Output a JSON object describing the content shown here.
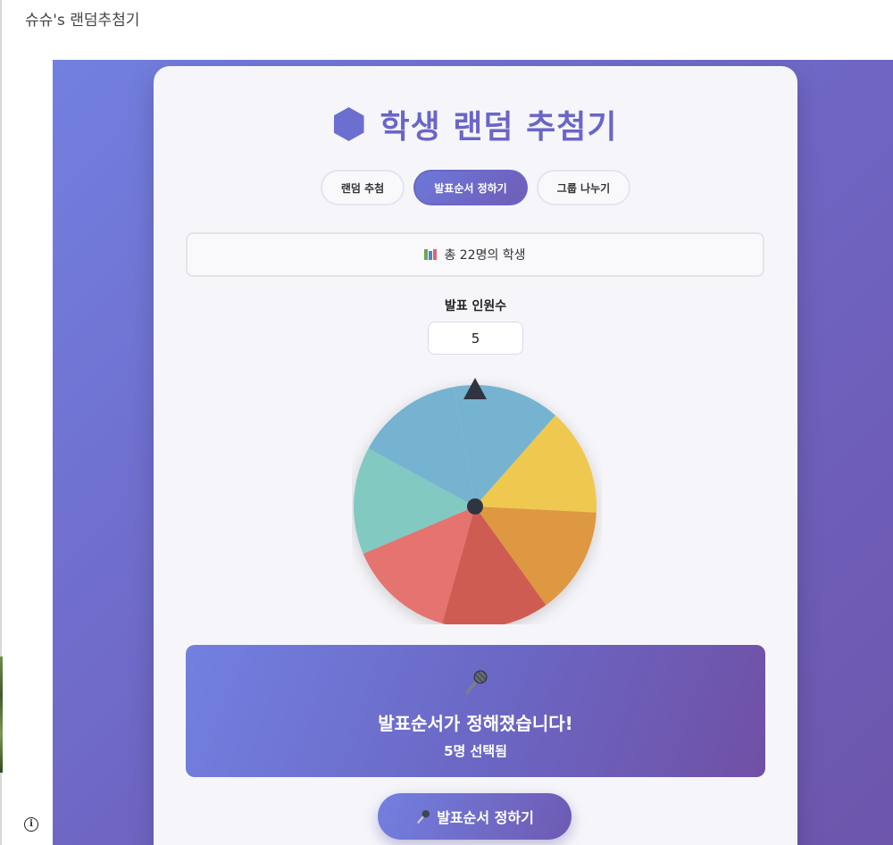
{
  "window": {
    "title": "슈슈's 랜덤추첨기"
  },
  "header": {
    "title": "학생 랜덤 추첨기",
    "icon": "hexagon-icon"
  },
  "tabs": [
    {
      "label": "랜덤 추첨",
      "active": false
    },
    {
      "label": "발표순서 정하기",
      "active": true
    },
    {
      "label": "그룹 나누기",
      "active": false
    }
  ],
  "summary": {
    "icon": "books-icon",
    "text": "총 22명의 학생"
  },
  "presenter_count": {
    "label": "발표 인원수",
    "value": "5"
  },
  "wheel": {
    "segments": 7,
    "colors": [
      "#74b3d0",
      "#efc94f",
      "#de9843",
      "#cf5b52",
      "#e5736f",
      "#82c9c2"
    ],
    "pointer_color": "#2f3440",
    "hub_color": "#2f3440"
  },
  "result": {
    "icon": "microphone-icon",
    "title": "발표순서가 정해졌습니다!",
    "subtitle": "5명 선택됨"
  },
  "action": {
    "icon": "microphone-icon",
    "label": "발표순서 정하기"
  },
  "colors": {
    "accent": "#6a66c8",
    "background_gradient_start": "#7280e0",
    "background_gradient_end": "#6d56ac"
  }
}
